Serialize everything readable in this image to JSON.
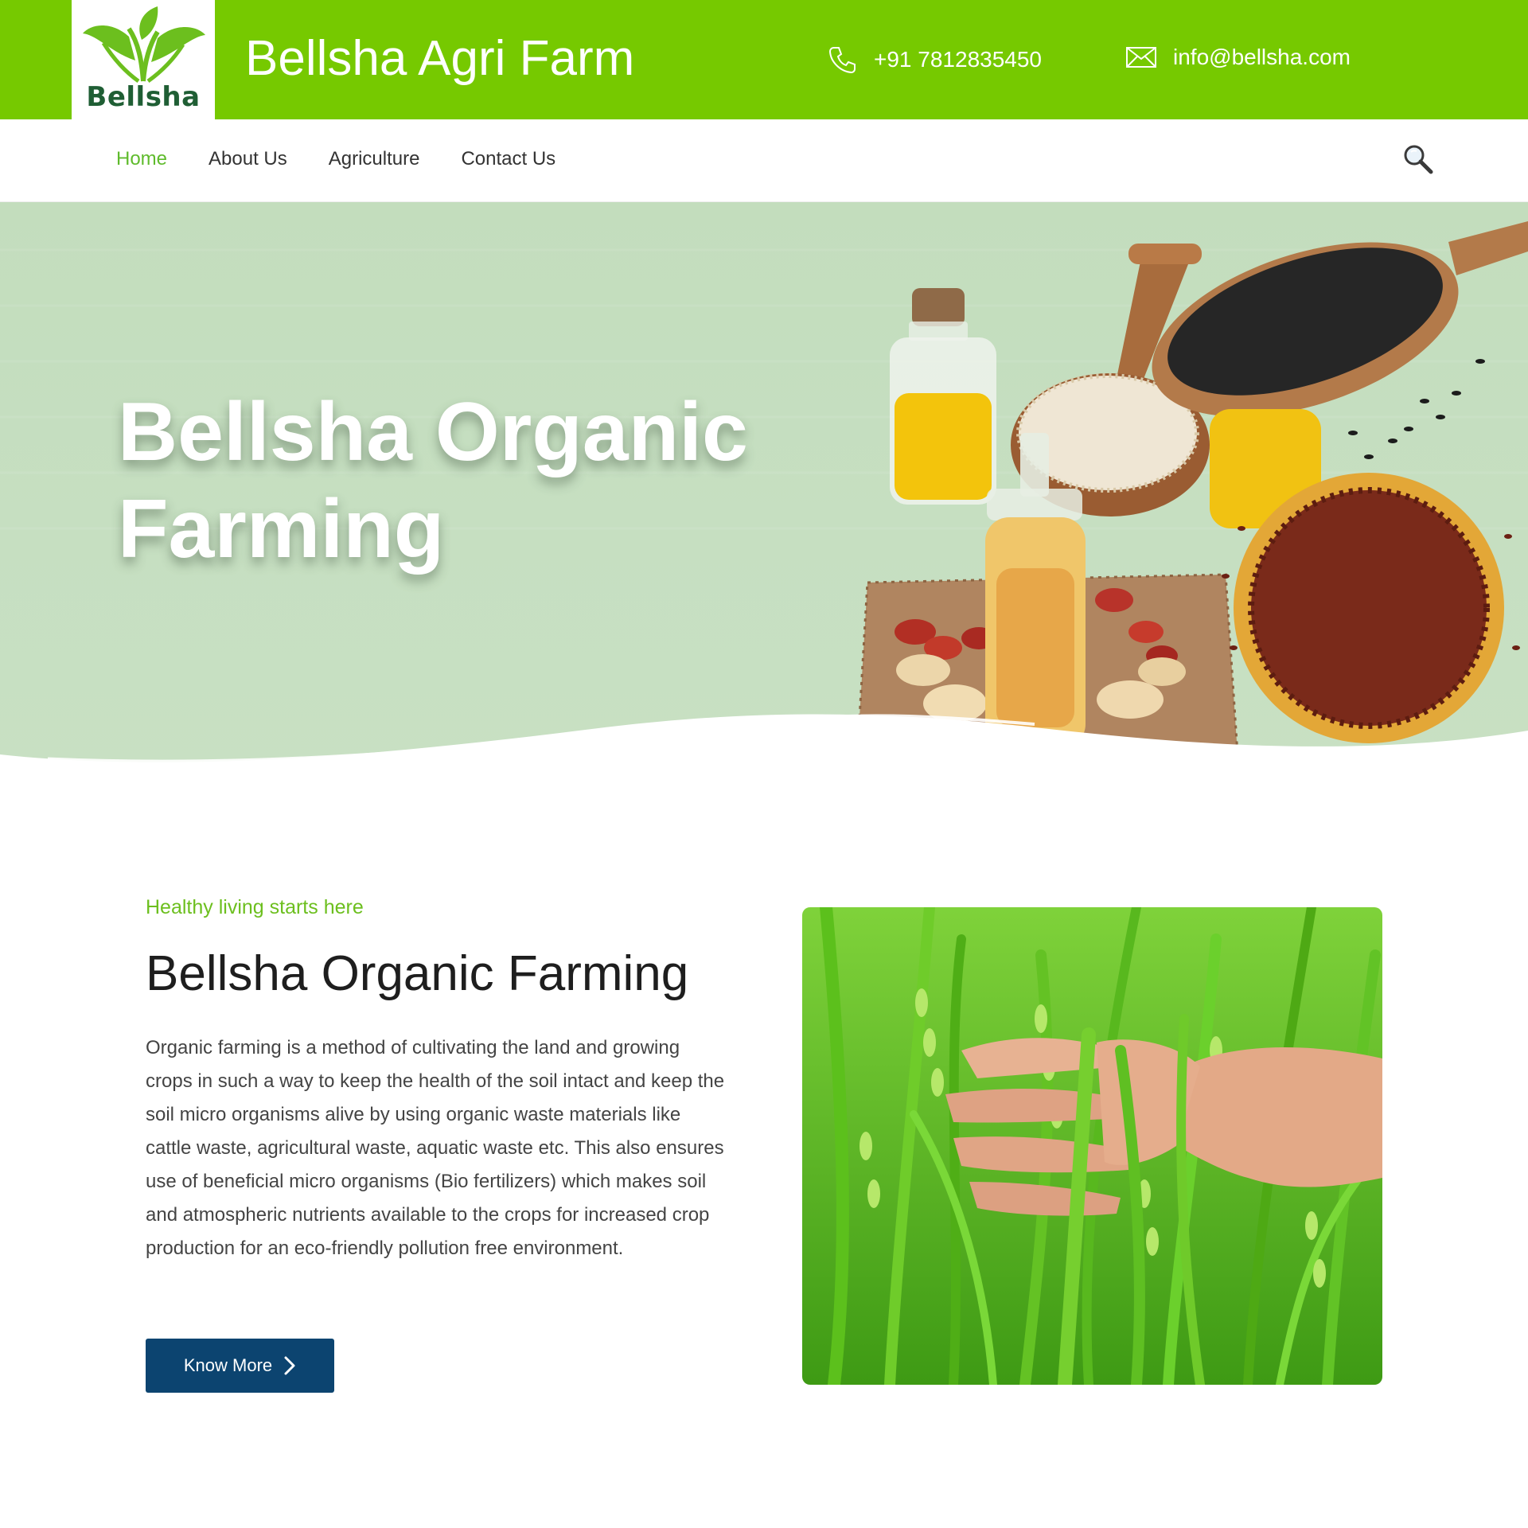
{
  "header": {
    "logo_text": "Bellsha",
    "site_title": "Bellsha Agri Farm",
    "phone": "+91 7812835450",
    "email": "info@bellsha.com"
  },
  "nav": {
    "items": [
      {
        "label": "Home",
        "active": true
      },
      {
        "label": "About Us",
        "active": false
      },
      {
        "label": "Agriculture",
        "active": false
      },
      {
        "label": "Contact Us",
        "active": false
      }
    ],
    "search_icon": "magnifier-icon"
  },
  "hero": {
    "title_line1": "Bellsha Organic",
    "title_line2": "Farming"
  },
  "intro": {
    "tagline": "Healthy living starts here",
    "title": "Bellsha Organic Farming",
    "body": "Organic farming is a method of cultivating the land and growing crops in such a way to keep the health of the soil intact and keep the soil micro organisms alive by using organic waste materials like cattle waste, agricultural waste, aquatic waste etc. This also ensures use of beneficial micro organisms (Bio fertilizers) which makes soil and atmospheric nutrients available to the crops for increased crop production for an eco-friendly pollution free environment.",
    "button_label": "Know More"
  },
  "colors": {
    "brand_green": "#76c900",
    "nav_active": "#5fbb2c",
    "hero_bg": "#c6dfc1",
    "button_bg": "#0c4470"
  }
}
